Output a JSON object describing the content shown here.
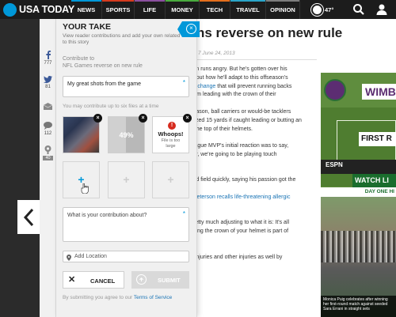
{
  "nav": {
    "brand": "USA TODAY",
    "items": [
      {
        "label": "NEWS",
        "color": "#0098d9"
      },
      {
        "label": "SPORTS",
        "color": "#d53a1e"
      },
      {
        "label": "LIFE",
        "color": "#8a4f9e"
      },
      {
        "label": "MONEY",
        "color": "#4aab3e"
      },
      {
        "label": "TECH",
        "color": "#e36e1c"
      },
      {
        "label": "TRAVEL",
        "color": "#2aa5c9"
      },
      {
        "label": "OPINION",
        "color": "#7c7c7c"
      }
    ],
    "temperature": "47°",
    "icons": [
      "weather-sun-icon",
      "search-icon",
      "user-icon"
    ]
  },
  "social": [
    {
      "icon": "facebook-icon",
      "count": "777"
    },
    {
      "icon": "twitter-icon",
      "count": "81"
    },
    {
      "icon": "email-icon",
      "count": ""
    },
    {
      "icon": "comment-icon",
      "count": "112"
    },
    {
      "icon": "your-take-icon",
      "count": "40"
    }
  ],
  "article": {
    "headline": "ns reverse on new rule",
    "meta": "7 June 24, 2013",
    "paragraphs": [
      {
        "segments": [
          {
            "text": "son runs angry. But he's gotten over his"
          }
        ]
      },
      {
        "segments": [
          {
            "text": "about how he'll adapt to this offseason's"
          }
        ]
      },
      {
        "segments": [
          {
            "text": "es change",
            "link": true
          },
          {
            "text": " that will prevent running backs"
          }
        ]
      },
      {
        "segments": [
          {
            "text": " from leading with the crown of their"
          }
        ]
      },
      {
        "segments": [
          {
            "text": ""
          }
        ]
      },
      {
        "segments": [
          {
            "text": "season, ball carriers or would-be tacklers"
          }
        ]
      },
      {
        "segments": [
          {
            "text": "alized 15 yards if caught leading or butting an"
          }
        ]
      },
      {
        "segments": [
          {
            "text": "h the top of their helmets."
          }
        ]
      },
      {
        "segments": [
          {
            "text": ""
          }
        ]
      },
      {
        "segments": [
          {
            "text": "league MVP's initial reaction was to say,"
          }
        ]
      },
      {
        "segments": [
          {
            "text": "ver, we're going to be playing touch"
          }
        ]
      },
      {
        "segments": [
          {
            "text": ""
          }
        ]
      },
      {
        "segments": [
          {
            "text": ""
          }
        ]
      },
      {
        "segments": [
          {
            "text": "sed field quickly, saying his passion got the"
          }
        ]
      },
      {
        "segments": [
          {
            "text": ""
          }
        ]
      },
      {
        "segments": [
          {
            "text": ": "
          },
          {
            "text": "Peterson recalls life-threatening allergic",
            "link": true
          }
        ]
      },
      {
        "segments": [
          {
            "text": ""
          }
        ]
      },
      {
        "segments": [
          {
            "text": ""
          }
        ]
      },
      {
        "segments": [
          {
            "text": "pretty much adjusting to what it is: It's all"
          }
        ]
      },
      {
        "segments": [
          {
            "text": "using the crown of your helmet is part of"
          }
        ]
      },
      {
        "segments": [
          {
            "text": ""
          }
        ]
      },
      {
        "segments": [
          {
            "text": ""
          }
        ]
      },
      {
        "segments": [
          {
            "text": "d injuries and other injuries as well by"
          }
        ]
      }
    ]
  },
  "ad": {
    "title": "WIMB",
    "court_sign": "FIRST R",
    "broadcaster": "ESPN",
    "cta": "WATCH LI",
    "dayone": "DAY ONE HI",
    "caption": "Monica Puig celebrates after winning her first-round match against seeded Sara Errani in straight sets"
  },
  "panel": {
    "title": "YOUR TAKE",
    "subtitle": "View reader contributions and add your own related to this story",
    "contrib_label_line1": "Contribute to",
    "contrib_label_line2": "NFL Games reverse on new rule",
    "title_value": "My great shots from the game",
    "upload_note": "You may contribute up to six files at a time",
    "progress": {
      "percent": 49,
      "label": "49%"
    },
    "error": {
      "title": "Whoops!",
      "message_line1": "File is too",
      "message_line2": "large"
    },
    "about_placeholder": "What is your contribution about?",
    "location_placeholder": "Add Location",
    "cancel_label": "CANCEL",
    "submit_label": "SUBMIT",
    "agree_text": "By submitting you agree to our ",
    "tos_label": "Terms of Service"
  },
  "colors": {
    "accent": "#0098d9",
    "error": "#d62b1e",
    "link": "#1a74b5"
  }
}
